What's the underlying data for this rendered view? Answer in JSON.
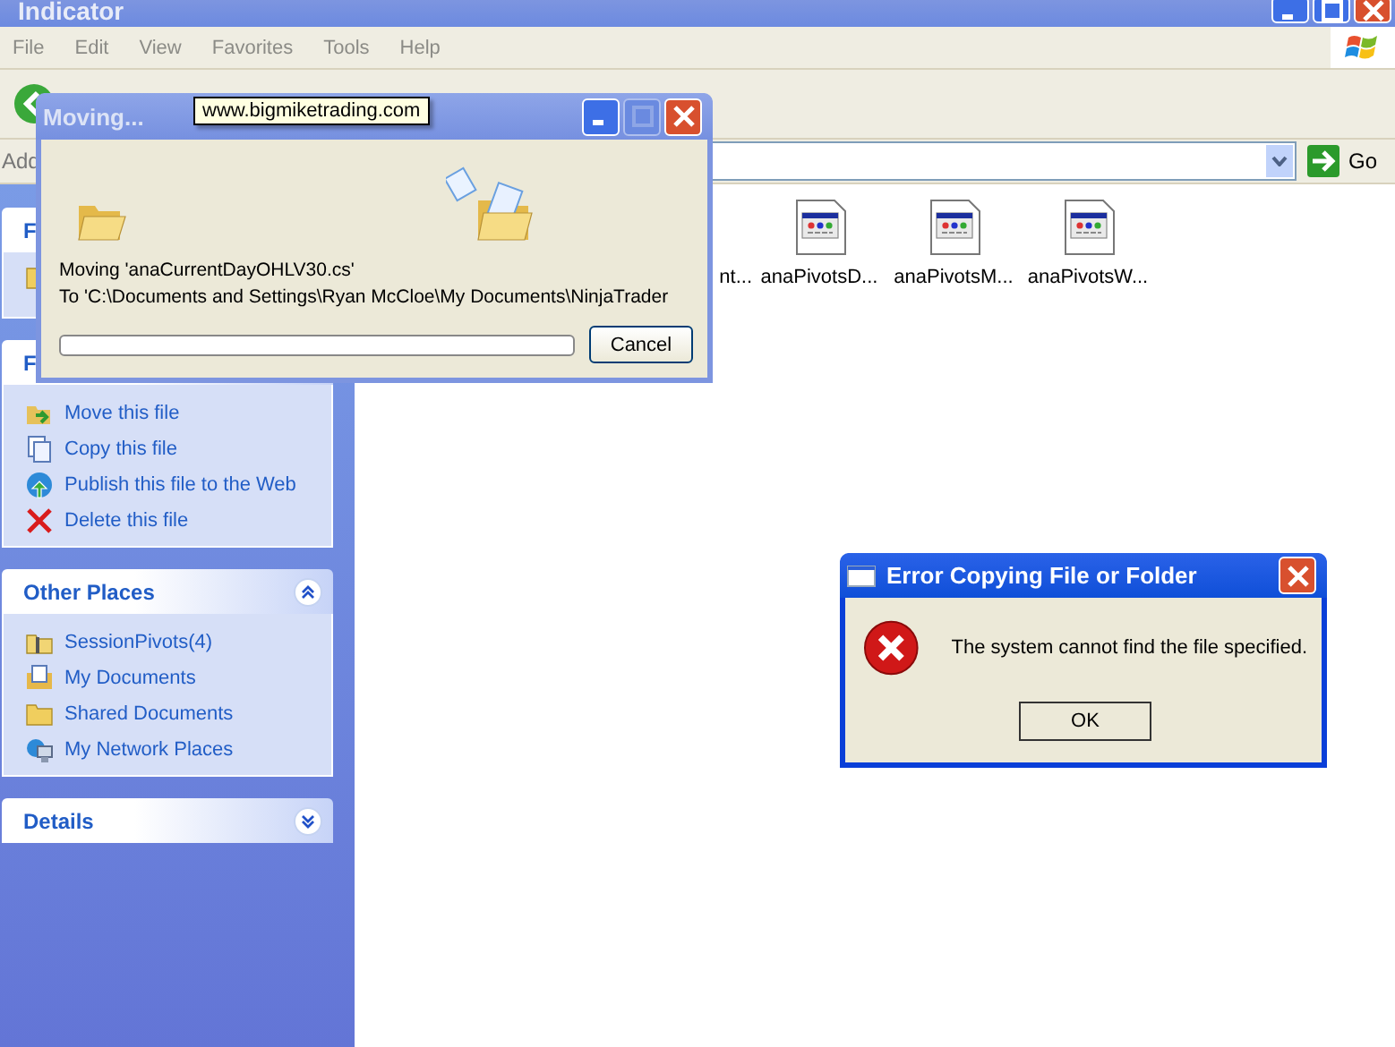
{
  "window": {
    "title": "Indicator",
    "menu": [
      "File",
      "Edit",
      "View",
      "Favorites",
      "Tools",
      "Help"
    ]
  },
  "address_bar": {
    "label": "Add",
    "go": "Go"
  },
  "sidebar": {
    "panels": [
      {
        "title": "F"
      },
      {
        "title": "F",
        "items": [
          {
            "text": "Move this file"
          },
          {
            "text": "Copy this file"
          },
          {
            "text": "Publish this file to the Web"
          },
          {
            "text": "Delete this file"
          }
        ]
      },
      {
        "title": "Other Places",
        "expanded": true,
        "items": [
          {
            "text": "SessionPivots(4)"
          },
          {
            "text": "My Documents"
          },
          {
            "text": "Shared Documents"
          },
          {
            "text": "My Network Places"
          }
        ]
      },
      {
        "title": "Details",
        "expanded": false
      }
    ]
  },
  "files": [
    {
      "name": "nt...",
      "kind": "cut"
    },
    {
      "name": "anaPivotsD...",
      "kind": "file"
    },
    {
      "name": "anaPivotsM...",
      "kind": "file"
    },
    {
      "name": "anaPivotsW...",
      "kind": "file"
    }
  ],
  "moving_dialog": {
    "title": "Moving...",
    "tooltip": "www.bigmiketrading.com",
    "line_1": "Moving 'anaCurrentDayOHLV30.cs'",
    "line_2": "To 'C:\\Documents and Settings\\Ryan McCloe\\My Documents\\NinjaTrader",
    "progress": {
      "level": 0
    },
    "button": "Cancel"
  },
  "error_dialog": {
    "title": "Error Copying File or Folder",
    "message": "The system cannot find the file specified.",
    "button": "OK"
  }
}
